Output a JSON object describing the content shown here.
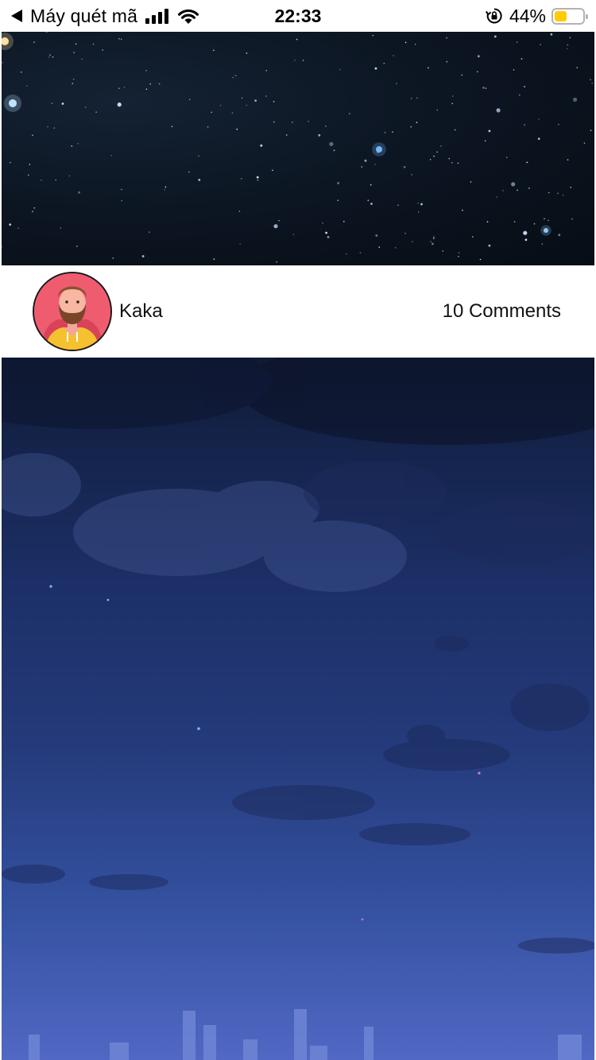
{
  "status_bar": {
    "back_label": "Máy quét mã",
    "time": "22:33",
    "battery_percent": "44%",
    "battery_level": 0.44,
    "battery_color": "#ffcc00",
    "icons": [
      "back-arrow-icon",
      "cellular-signal-icon",
      "wifi-icon",
      "orientation-lock-icon",
      "battery-icon"
    ]
  },
  "post": {
    "author_name": "Kaka",
    "comments": "10 Comments",
    "avatar_icon": "bearded-man-avatar"
  }
}
